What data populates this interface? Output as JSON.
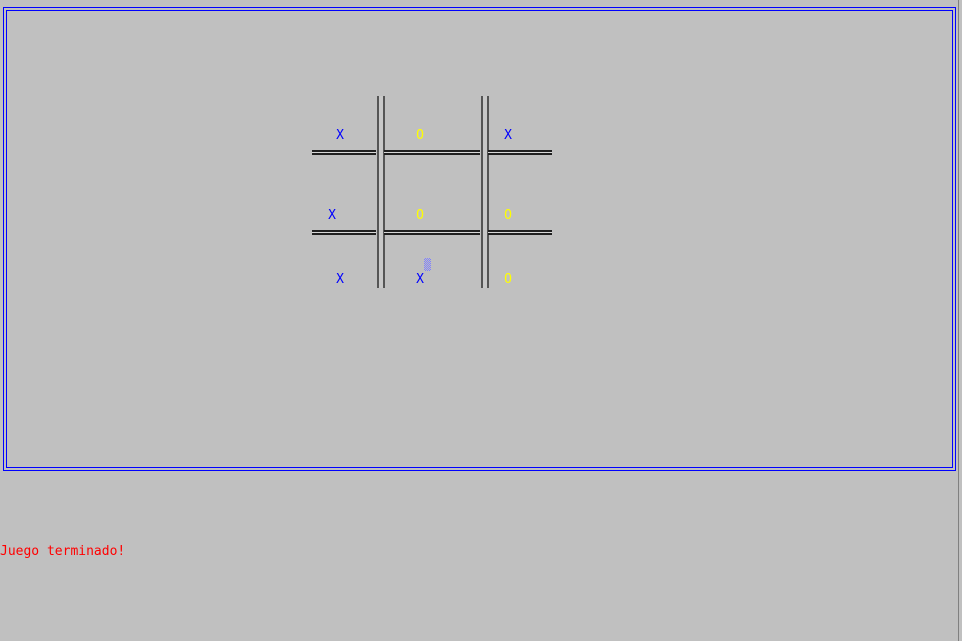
{
  "board": {
    "cells": [
      {
        "mark": "X",
        "player": "x"
      },
      {
        "mark": "O",
        "player": "o"
      },
      {
        "mark": "X",
        "player": "x"
      },
      {
        "mark": "X",
        "player": "x"
      },
      {
        "mark": "O",
        "player": "o"
      },
      {
        "mark": "O",
        "player": "o"
      },
      {
        "mark": "X",
        "player": "x"
      },
      {
        "mark": "X",
        "player": "x"
      },
      {
        "mark": "O",
        "player": "o"
      }
    ]
  },
  "status": {
    "message": "Juego terminado!"
  },
  "colors": {
    "background": "#c0c0c0",
    "frame": "#0000ff",
    "x_mark": "#0000ff",
    "o_mark": "#ffff00",
    "status": "#ff0000"
  }
}
